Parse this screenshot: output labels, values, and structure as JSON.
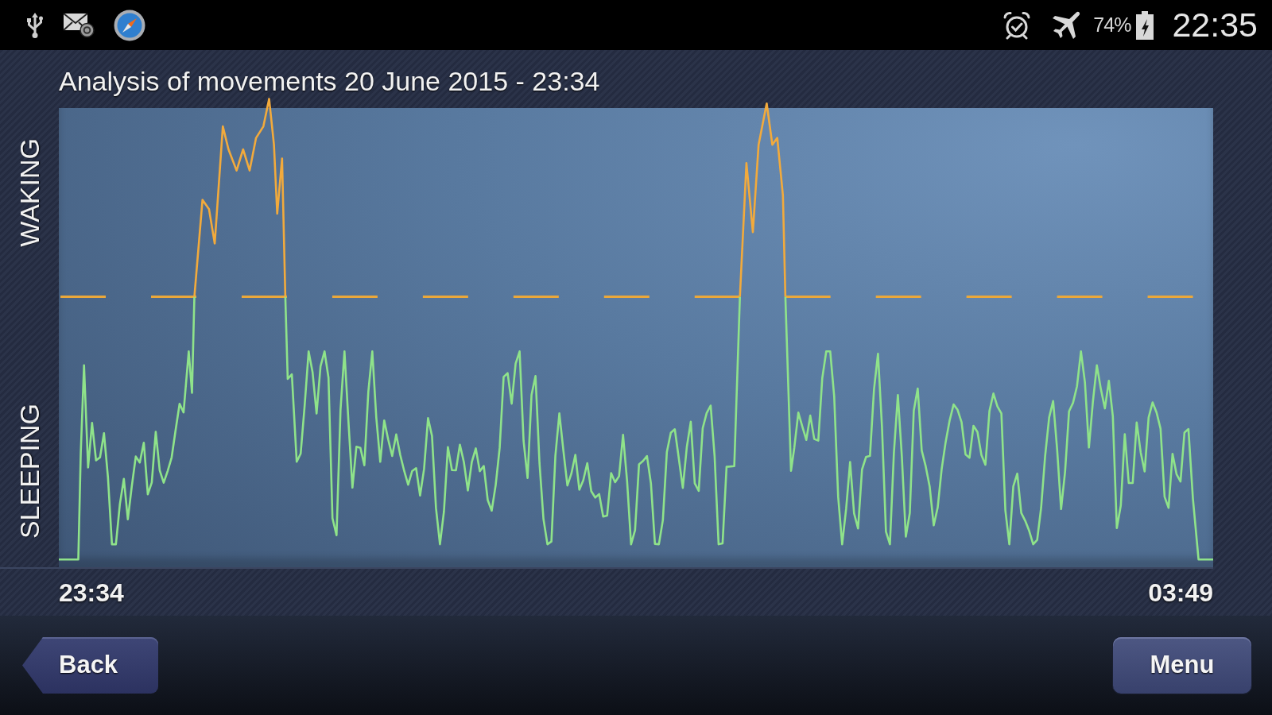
{
  "status_bar": {
    "battery": "74%",
    "time": "22:35"
  },
  "chart": {
    "title": "Analysis of movements 20 June 2015 - 23:34",
    "upper_label": "WAKING",
    "lower_label": "SLEEPING",
    "start_time": "23:34",
    "end_time": "03:49"
  },
  "buttons": [
    {
      "kind": "back",
      "label": "Back"
    },
    {
      "kind": "plain",
      "label": "Menu"
    }
  ]
}
